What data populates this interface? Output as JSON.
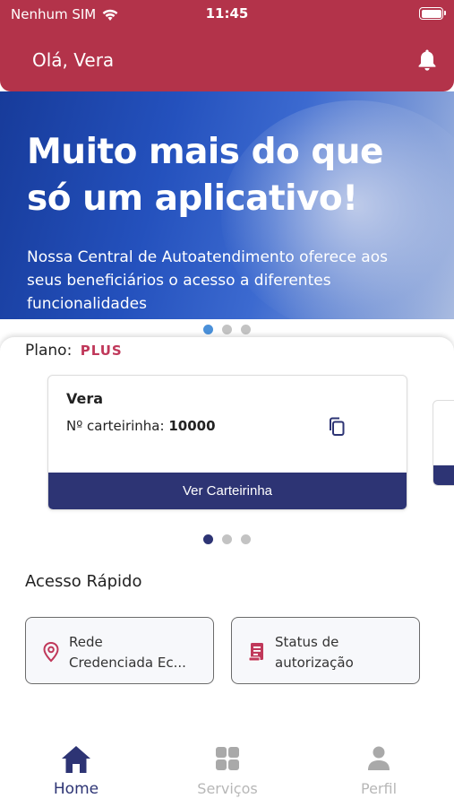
{
  "status_bar": {
    "carrier": "Nenhum SIM",
    "time": "11:45",
    "wifi_icon": "wifi-icon",
    "battery_level": 1.0
  },
  "header": {
    "greeting": "Olá, Vera",
    "notification_icon": "bell-icon",
    "background_color": "#b3334a"
  },
  "banner": {
    "title_line1": "Muito mais do que",
    "title_line2": "só um aplicativo!",
    "subtitle": "Nossa Central de Autoatendimento oferece aos seus beneficiários o acesso a diferentes funcionalidades",
    "page_count": 3,
    "active_page": 1
  },
  "plan": {
    "label": "Plano:",
    "value": "PLUS"
  },
  "card": {
    "holder_name": "Vera",
    "number_label": "Nº carteirinha:",
    "number_value": "10000",
    "copy_icon": "copy-icon",
    "button_label": "Ver Carteirinha",
    "page_count": 3,
    "active_page": 1
  },
  "quick_access": {
    "title": "Acesso Rápido",
    "items": [
      {
        "label_line1": "Rede",
        "label_line2": "Credenciada Ec...",
        "icon": "location-pin-icon"
      },
      {
        "label_line1": "Status de",
        "label_line2": "autorização",
        "icon": "receipt-icon"
      }
    ]
  },
  "bottom_nav": {
    "items": [
      {
        "label": "Home",
        "icon": "home-icon",
        "active": true
      },
      {
        "label": "Serviços",
        "icon": "grid-icon",
        "active": false
      },
      {
        "label": "Perfil",
        "icon": "user-icon",
        "active": false
      }
    ]
  },
  "colors": {
    "primary": "#2d3474",
    "accent": "#c0385a",
    "header": "#b3334a",
    "inactive": "#b7b7b7"
  }
}
